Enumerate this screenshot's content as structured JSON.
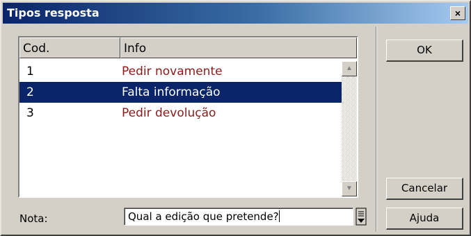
{
  "window": {
    "title": "Tipos resposta",
    "close_label": "×"
  },
  "list": {
    "columns": [
      "Cod.",
      "Info"
    ],
    "rows": [
      {
        "cod": "1",
        "info": "Pedir novamente",
        "selected": false
      },
      {
        "cod": "2",
        "info": "Falta informação",
        "selected": true
      },
      {
        "cod": "3",
        "info": "Pedir devolução",
        "selected": false
      }
    ],
    "scroll_up_icon": "arrow-up-icon",
    "scroll_down_icon": "arrow-down-icon"
  },
  "buttons": {
    "ok": "OK",
    "cancel": "Cancelar",
    "help": "Ajuda"
  },
  "nota": {
    "label": "Nota:",
    "value": "Qual a edição que pretende?",
    "dropdown_icon": "list-dropdown-icon"
  },
  "colors": {
    "selection": "#0a246a",
    "info_text": "#8b1a1a",
    "face": "#d4d0c8",
    "title_start": "#0a246a",
    "title_end": "#a6caf0"
  }
}
